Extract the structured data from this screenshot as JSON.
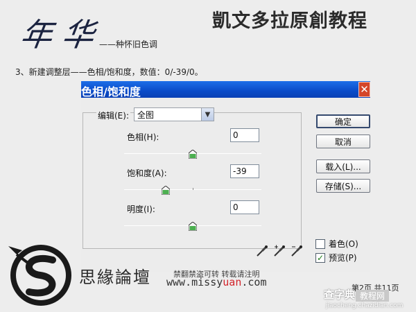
{
  "header": {
    "calligraphy": "年华",
    "subtitle": "——种怀旧色调",
    "brand": "凱文多拉原創教程"
  },
  "step": "3、新建调整层——色相/饱和度，数值：0/-39/0。",
  "dialog": {
    "title": "色相/饱和度",
    "close_label": "✕",
    "edit_label": "编辑(E):",
    "edit_value": "全图",
    "hue": {
      "label": "色相(H):",
      "value": "0",
      "slider_fraction": 0.5
    },
    "saturation": {
      "label": "饱和度(A):",
      "value": "-39",
      "slider_fraction": 0.305
    },
    "lightness": {
      "label": "明度(I):",
      "value": "0",
      "slider_fraction": 0.5
    },
    "buttons": {
      "ok": "确定",
      "cancel": "取消",
      "load": "载入(L)...",
      "save": "存储(S)..."
    },
    "colorize": {
      "label": "着色(O)",
      "checked": false
    },
    "preview": {
      "label": "预览(P)",
      "checked": true
    },
    "eyedroppers": [
      "eyedropper-icon",
      "eyedropper-plus-icon",
      "eyedropper-minus-icon"
    ]
  },
  "footer": {
    "site_name": "思緣論壇",
    "notice": "禁翻禁盗可转 转载请注明",
    "url_prefix": "www.missy",
    "url_accent": "uan",
    "url_suffix": ".com",
    "page_indicator": "第2页 共11页"
  },
  "watermark": {
    "main": "查字典",
    "badge": "教程网",
    "url": "jiaocheng.chazidian.com"
  },
  "colors": {
    "titlebar": "#0a4bc8",
    "accent_red": "#d2232a",
    "background": "#ededed"
  }
}
